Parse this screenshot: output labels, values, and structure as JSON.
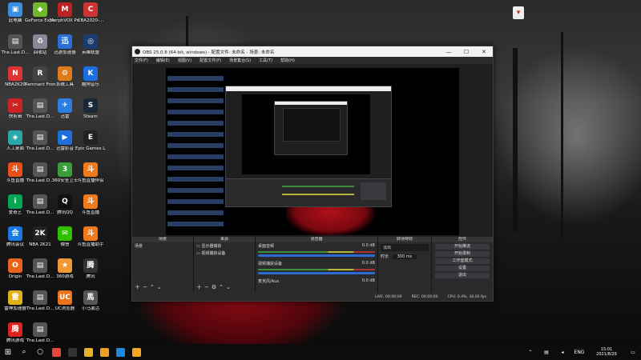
{
  "desktop": {
    "icons": [
      {
        "label": "此电脑",
        "color": "#3a8ee6",
        "glyph": "▣"
      },
      {
        "label": "GeForce Experience",
        "color": "#6fb82a",
        "glyph": "◆"
      },
      {
        "label": "MorphVOX Pro",
        "color": "#b22",
        "glyph": "M"
      },
      {
        "label": "CBA2020-...",
        "color": "#c33",
        "glyph": "C"
      },
      {
        "label": "The.Last.D...",
        "color": "#555",
        "glyph": "▤"
      },
      {
        "label": "回收站",
        "color": "#889",
        "glyph": "♻"
      },
      {
        "label": "迅游加速器",
        "color": "#2b6fd6",
        "glyph": "迅"
      },
      {
        "label": "英雄联盟",
        "color": "#1a3c6e",
        "glyph": "◎"
      },
      {
        "label": "NBA2K20",
        "color": "#d33",
        "glyph": "N"
      },
      {
        "label": "Remnant From...",
        "color": "#444",
        "glyph": "R"
      },
      {
        "label": "系统工具",
        "color": "#e07b1b",
        "glyph": "⚙"
      },
      {
        "label": "酷狗音乐",
        "color": "#1b6fe0",
        "glyph": "K"
      },
      {
        "label": "快剪辑",
        "color": "#c22",
        "glyph": "✂"
      },
      {
        "label": "The.Last.D...",
        "color": "#555",
        "glyph": "▤"
      },
      {
        "label": "迅雷",
        "color": "#2a7de1",
        "glyph": "✈"
      },
      {
        "label": "Steam",
        "color": "#1b2838",
        "glyph": "S"
      },
      {
        "label": "人工桌面",
        "color": "#2aa8a8",
        "glyph": "◈"
      },
      {
        "label": "The.Last.D...",
        "color": "#555",
        "glyph": "▤"
      },
      {
        "label": "迅雷影音",
        "color": "#1e6fd9",
        "glyph": "▶"
      },
      {
        "label": "Epic Games Launcher",
        "color": "#222",
        "glyph": "E"
      },
      {
        "label": "斗鱼直播",
        "color": "#e8501a",
        "glyph": "斗"
      },
      {
        "label": "The.Last.D...",
        "color": "#555",
        "glyph": "▤"
      },
      {
        "label": "360安全卫士",
        "color": "#3c9d3c",
        "glyph": "3"
      },
      {
        "label": "斗鱼直播伴侣",
        "color": "#f07a1a",
        "glyph": "斗"
      },
      {
        "label": "爱奇艺",
        "color": "#00a651",
        "glyph": "i"
      },
      {
        "label": "The.Last.D...",
        "color": "#555",
        "glyph": "▤"
      },
      {
        "label": "腾讯QQ",
        "color": "#111",
        "glyph": "Q"
      },
      {
        "label": "斗鱼直播",
        "color": "#f07a1a",
        "glyph": "斗"
      },
      {
        "label": "腾讯会议",
        "color": "#1b7ae0",
        "glyph": "会"
      },
      {
        "label": "NBA 2K21",
        "color": "#222",
        "glyph": "2K"
      },
      {
        "label": "微信",
        "color": "#2dc100",
        "glyph": "✉"
      },
      {
        "label": "斗鱼直播助手",
        "color": "#f07a1a",
        "glyph": "斗"
      },
      {
        "label": "Origin",
        "color": "#e8631a",
        "glyph": "O"
      },
      {
        "label": "The.Last.D...",
        "color": "#555",
        "glyph": "▤"
      },
      {
        "label": "360游戏",
        "color": "#e93",
        "glyph": "★"
      },
      {
        "label": "腾讯",
        "color": "#333",
        "glyph": "腾"
      },
      {
        "label": "雷神加速器",
        "color": "#e0b21a",
        "glyph": "雷"
      },
      {
        "label": "The.Last.D...",
        "color": "#555",
        "glyph": "▤"
      },
      {
        "label": "UC浏览器",
        "color": "#e8731a",
        "glyph": "UC"
      },
      {
        "label": "小马激活",
        "color": "#555",
        "glyph": "馬"
      },
      {
        "label": "腾讯游戏",
        "color": "#d22",
        "glyph": "腾"
      },
      {
        "label": "The.Last.D...",
        "color": "#555",
        "glyph": "▤"
      }
    ],
    "topright_icon_label": "",
    "accent_blood": "#a00a14"
  },
  "obs": {
    "title": "OBS 25.0.8 (64-bit, windows) - 配置文件: 未命名 - 场景: 未命名",
    "window_controls": [
      "—",
      "☐",
      "✕"
    ],
    "menu": [
      "文件(F)",
      "编辑(E)",
      "视图(V)",
      "配置文件(P)",
      "场景集合(S)",
      "工具(T)",
      "帮助(H)"
    ],
    "docks": {
      "scenes": {
        "header": "场景",
        "items": [
          "场景"
        ]
      },
      "sources": {
        "header": "来源",
        "items": [
          "显示器捕获",
          "视频捕获设备"
        ]
      },
      "mixer": {
        "header": "混音器",
        "channels": [
          {
            "name": "桌面音频",
            "db": "0.0 dB"
          },
          {
            "name": "视频捕获设备",
            "db": "0.0 dB"
          },
          {
            "name": "麦克风/Aux",
            "db": "0.0 dB"
          }
        ]
      },
      "transitions": {
        "header": "转场特效",
        "type": "淡出",
        "duration_label": "时长",
        "duration": "300 ms"
      },
      "controls": {
        "header": "控件",
        "buttons": [
          "开始推流",
          "开始录制",
          "工作室模式",
          "设置",
          "退出"
        ]
      }
    },
    "status": {
      "live": "LIVE: 00:00:00",
      "rec": "REC: 00:00:00",
      "cpu": "CPU: 0.4%, 30.00 fps"
    }
  },
  "taskbar": {
    "apps": [
      {
        "name": "chrome",
        "color": "#e8453c"
      },
      {
        "name": "obs",
        "color": "#333"
      },
      {
        "name": "file-explorer",
        "color": "#e6b422"
      },
      {
        "name": "app-orange",
        "color": "#f0a020"
      },
      {
        "name": "app-blue",
        "color": "#1e88e5"
      },
      {
        "name": "app-yellow",
        "color": "#f5a623"
      }
    ],
    "tray_lang": "ENG",
    "time": "15:01",
    "date": "2021/8/29"
  }
}
